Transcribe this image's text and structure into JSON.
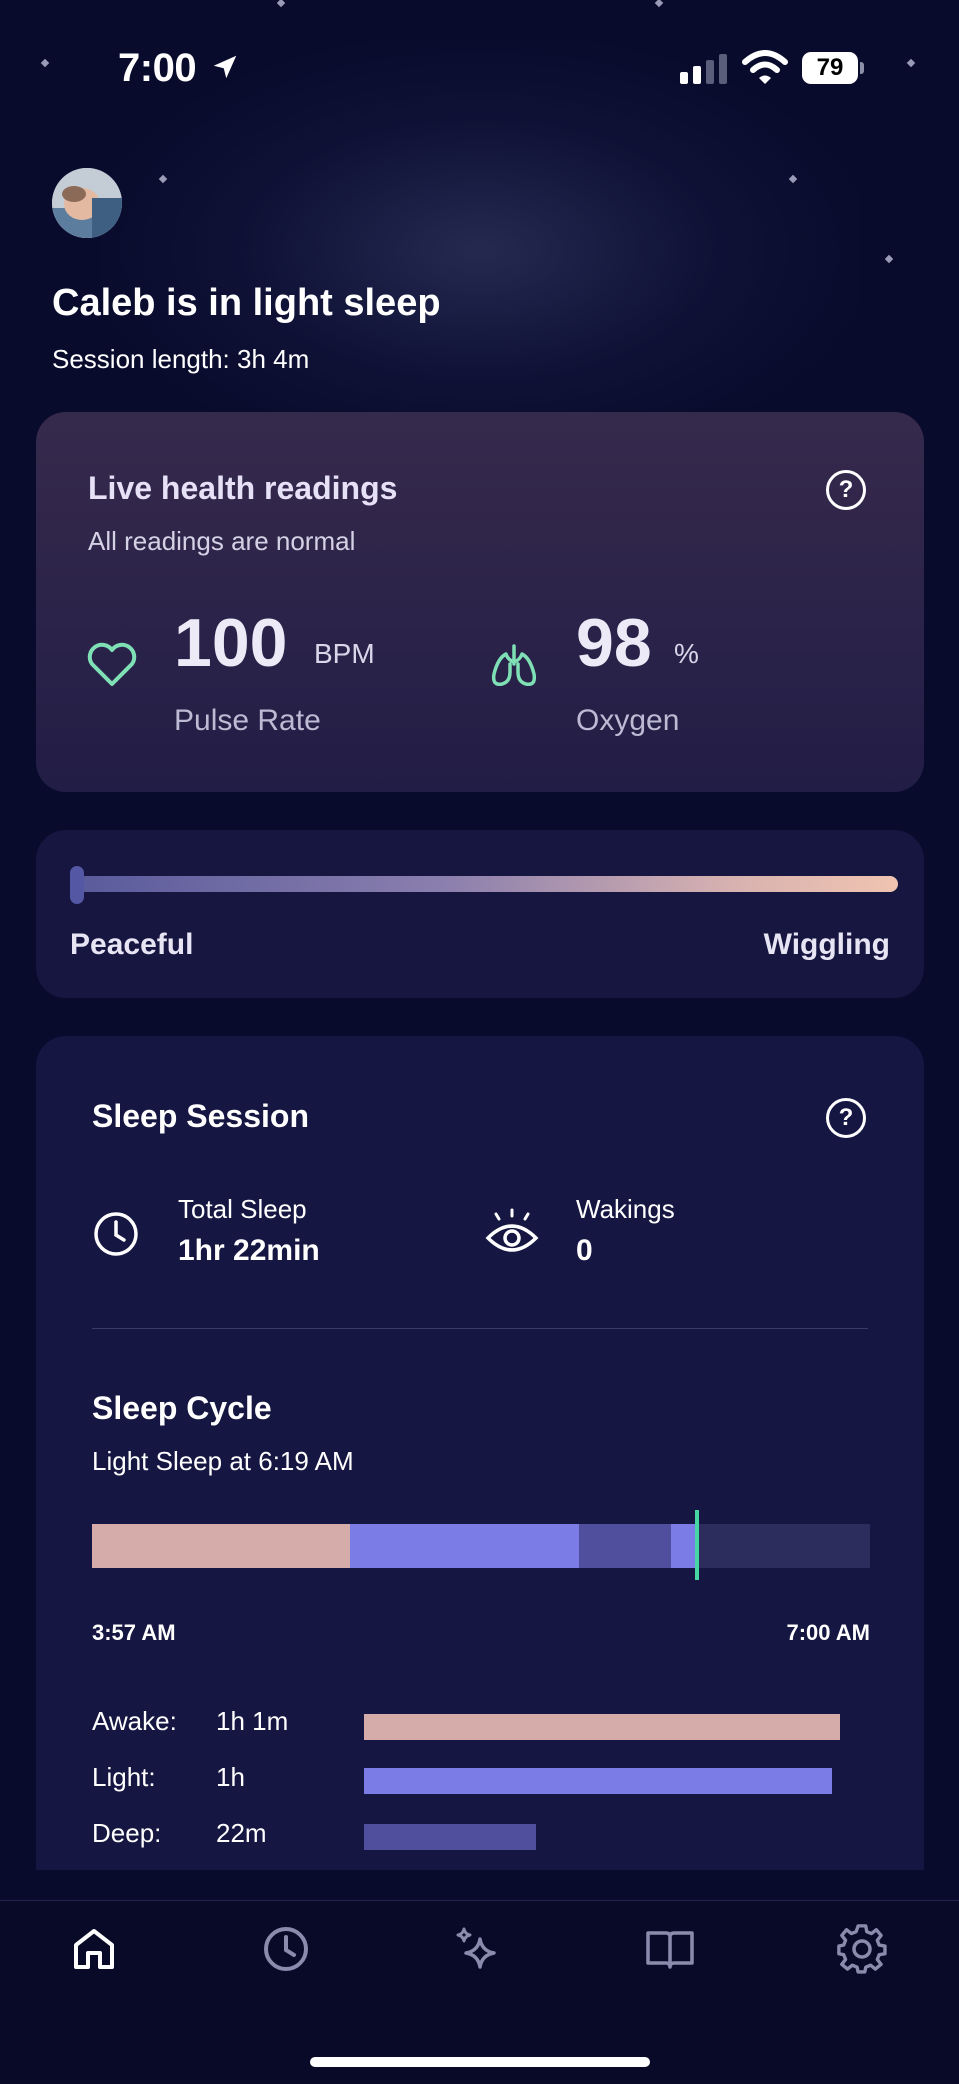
{
  "status_bar": {
    "time": "7:00",
    "battery": "79"
  },
  "header": {
    "title": "Caleb  is in light sleep",
    "session_length": "Session length: 3h 4m"
  },
  "health": {
    "title": "Live health readings",
    "subtitle": "All readings are normal",
    "pulse": {
      "value": "100",
      "unit": "BPM",
      "label": "Pulse Rate"
    },
    "oxygen": {
      "value": "98",
      "unit": "%",
      "label": "Oxygen"
    }
  },
  "motion": {
    "left_label": "Peaceful",
    "right_label": "Wiggling",
    "level": 0.0
  },
  "session": {
    "title": "Sleep Session",
    "total_sleep": {
      "label": "Total Sleep",
      "value": "1hr 22min"
    },
    "wakings": {
      "label": "Wakings",
      "value": "0"
    },
    "cycle": {
      "title": "Sleep Cycle",
      "subtitle": "Light Sleep at 6:19 AM",
      "start_time": "3:57 AM",
      "end_time": "7:00 AM",
      "segments": [
        {
          "stage": "awake",
          "fraction": 0.332
        },
        {
          "stage": "light",
          "fraction": 0.294
        },
        {
          "stage": "deep",
          "fraction": 0.118
        },
        {
          "stage": "light",
          "fraction": 0.033
        },
        {
          "stage": "remaining",
          "fraction": 0.223
        }
      ],
      "now_fraction": 0.777
    },
    "breakdown": [
      {
        "label": "Awake:",
        "value": "1h 1m",
        "stage": "awake",
        "fraction": 0.61
      },
      {
        "label": "Light:",
        "value": "1h",
        "stage": "light",
        "fraction": 0.6
      },
      {
        "label": "Deep:",
        "value": "22m",
        "stage": "deep",
        "fraction": 0.22
      }
    ]
  },
  "colors": {
    "awake": "#d6acaa",
    "light": "#7b7ce6",
    "deep": "#4f4f9e",
    "remaining": "#2c2d5c",
    "accent": "#46d6a4"
  },
  "tabs": [
    {
      "name": "home-icon",
      "active": true
    },
    {
      "name": "history-clock-icon",
      "active": false
    },
    {
      "name": "sparkles-icon",
      "active": false
    },
    {
      "name": "book-icon",
      "active": false
    },
    {
      "name": "settings-gear-icon",
      "active": false
    }
  ]
}
